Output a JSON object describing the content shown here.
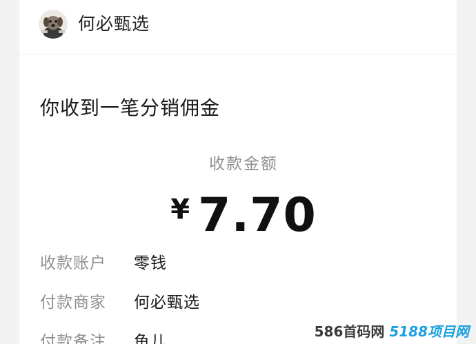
{
  "header": {
    "merchant_name": "何必甄选",
    "avatar_icon": "dog-avatar-icon"
  },
  "notice": {
    "title": "你收到一笔分销佣金"
  },
  "amount": {
    "label": "收款金额",
    "currency": "¥",
    "value": "7.70"
  },
  "details": [
    {
      "label": "收款账户",
      "value": "零钱"
    },
    {
      "label": "付款商家",
      "value": "何必甄选"
    },
    {
      "label": "付款备注",
      "value": "鱼儿"
    }
  ],
  "watermark": {
    "text": "586首码网",
    "accent": "5188项目网"
  }
}
